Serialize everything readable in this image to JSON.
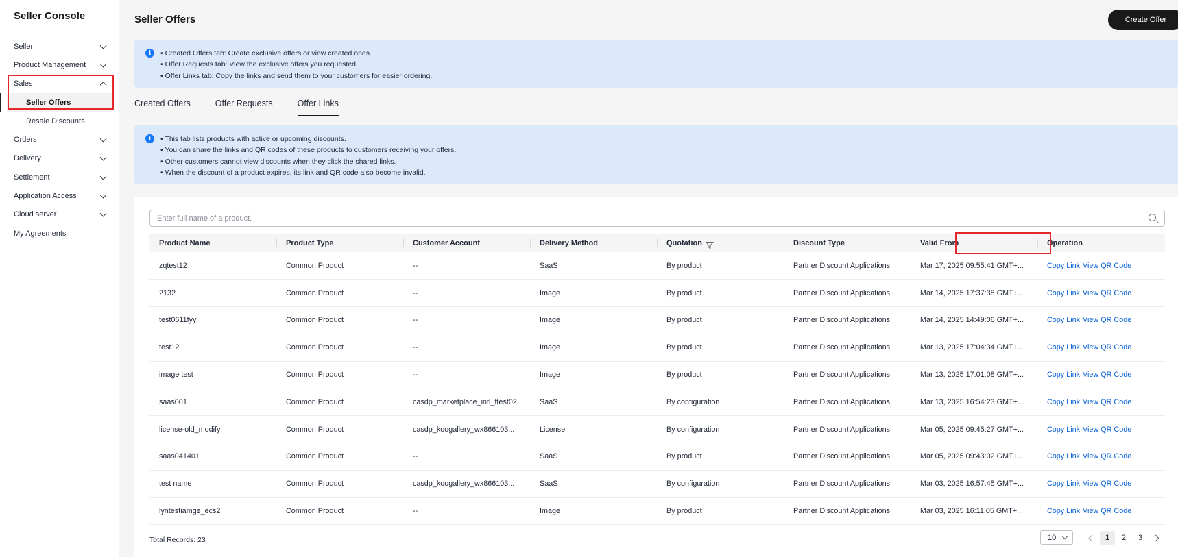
{
  "sidebar": {
    "title": "Seller Console",
    "items": [
      {
        "label": "Seller",
        "expandable": true
      },
      {
        "label": "Product Management",
        "expandable": true
      },
      {
        "label": "Sales",
        "expandable": true,
        "expanded": true
      },
      {
        "label": "Seller Offers",
        "sub": true,
        "active": true
      },
      {
        "label": "Resale Discounts",
        "sub": true
      },
      {
        "label": "Orders",
        "expandable": true
      },
      {
        "label": "Delivery",
        "expandable": true
      },
      {
        "label": "Settlement",
        "expandable": true
      },
      {
        "label": "Application Access",
        "expandable": true
      },
      {
        "label": "Cloud server",
        "expandable": true
      },
      {
        "label": "My Agreements",
        "expandable": false
      }
    ]
  },
  "header": {
    "title": "Seller Offers",
    "create_label": "Create Offer"
  },
  "info_top": {
    "lines": [
      "• Created Offers tab: Create exclusive offers or view created ones.",
      "• Offer Requests tab: View the exclusive offers you requested.",
      "• Offer Links tab: Copy the links and send them to your customers for easier ordering."
    ]
  },
  "tabs": [
    {
      "label": "Created Offers"
    },
    {
      "label": "Offer Requests"
    },
    {
      "label": "Offer Links",
      "active": true
    }
  ],
  "info_links": {
    "lines": [
      "• This tab lists products with active or upcoming discounts.",
      "• You can share the links and QR codes of these products to customers receiving your offers.",
      "• Other customers cannot view discounts when they click the shared links.",
      "• When the discount of a product expires, its link and QR code also become invalid."
    ]
  },
  "search": {
    "placeholder": "Enter full name of a product."
  },
  "table": {
    "columns": [
      "Product Name",
      "Product Type",
      "Customer Account",
      "Delivery Method",
      "Quotation",
      "Discount Type",
      "Valid From",
      "Operation"
    ],
    "copy_label": "Copy Link",
    "qr_label": "View QR Code",
    "rows": [
      [
        "zqtest12",
        "Common Product",
        "--",
        "SaaS",
        "By product",
        "Partner Discount Applications",
        "Mar 17, 2025 09:55:41 GMT+..."
      ],
      [
        "2132",
        "Common Product",
        "--",
        "Image",
        "By product",
        "Partner Discount Applications",
        "Mar 14, 2025 17:37:38 GMT+..."
      ],
      [
        "test0611fyy",
        "Common Product",
        "--",
        "Image",
        "By product",
        "Partner Discount Applications",
        "Mar 14, 2025 14:49:06 GMT+..."
      ],
      [
        "test12",
        "Common Product",
        "--",
        "Image",
        "By product",
        "Partner Discount Applications",
        "Mar 13, 2025 17:04:34 GMT+..."
      ],
      [
        "image test",
        "Common Product",
        "--",
        "Image",
        "By product",
        "Partner Discount Applications",
        "Mar 13, 2025 17:01:08 GMT+..."
      ],
      [
        "saas001",
        "Common Product",
        "casdp_marketplace_intl_ftest02",
        "SaaS",
        "By configuration",
        "Partner Discount Applications",
        "Mar 13, 2025 16:54:23 GMT+..."
      ],
      [
        "license-old_modify",
        "Common Product",
        "casdp_koogallery_wx866103...",
        "License",
        "By configuration",
        "Partner Discount Applications",
        "Mar 05, 2025 09:45:27 GMT+..."
      ],
      [
        "saas041401",
        "Common Product",
        "--",
        "SaaS",
        "By product",
        "Partner Discount Applications",
        "Mar 05, 2025 09:43:02 GMT+..."
      ],
      [
        "test name",
        "Common Product",
        "casdp_koogallery_wx866103...",
        "SaaS",
        "By configuration",
        "Partner Discount Applications",
        "Mar 03, 2025 16:57:45 GMT+..."
      ],
      [
        "lyntestiamge_ecs2",
        "Common Product",
        "--",
        "Image",
        "By product",
        "Partner Discount Applications",
        "Mar 03, 2025 16:11:05 GMT+..."
      ]
    ]
  },
  "footer": {
    "total": "Total Records: 23",
    "page_size": "10",
    "pages": [
      "1",
      "2",
      "3"
    ],
    "current_page": "1"
  },
  "colors": {
    "accent_link": "#0b63d6",
    "highlight": "#e5262d",
    "info_bg": "#dbe9fb",
    "primary_button": "#1a1a1a"
  }
}
